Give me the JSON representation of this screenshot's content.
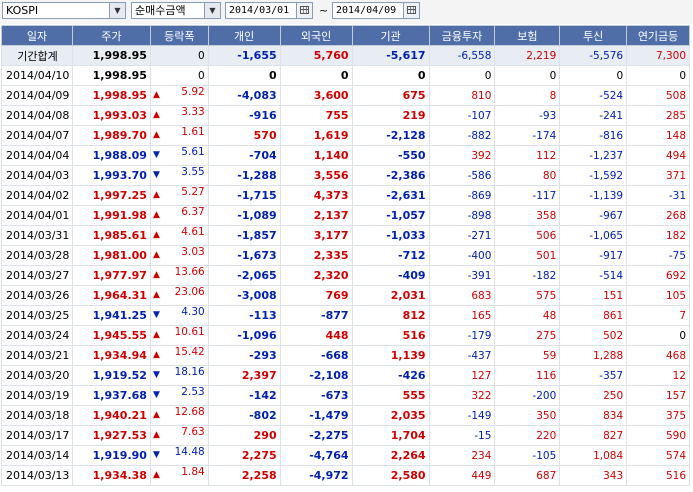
{
  "toolbar": {
    "market": "KOSPI",
    "mode": "순매수금액",
    "start_date": "2014/03/01",
    "tilde": "~",
    "end_date": "2014/04/09"
  },
  "headers": [
    "일자",
    "주가",
    "등락폭",
    "개인",
    "외국인",
    "기관",
    "금융투자",
    "보험",
    "투신",
    "연기금등"
  ],
  "colors": {
    "up": "#d00000",
    "down": "#0020b0",
    "header": "#4f6ea8"
  },
  "rows": [
    {
      "date": "기간합계",
      "price": "1,998.95",
      "dir": "",
      "chg": "0",
      "ind": "-1,655",
      "frn": "5,760",
      "ins": "-5,617",
      "fin": "-6,558",
      "insu": "2,219",
      "trust": "-5,576",
      "pen": "7,300",
      "total": true
    },
    {
      "date": "2014/04/10",
      "price": "1,998.95",
      "dir": "",
      "chg": "0",
      "ind": "0",
      "frn": "0",
      "ins": "0",
      "fin": "0",
      "insu": "0",
      "trust": "0",
      "pen": "0"
    },
    {
      "date": "2014/04/09",
      "price": "1,998.95",
      "dir": "up",
      "chg": "5.92",
      "ind": "-4,083",
      "frn": "3,600",
      "ins": "675",
      "fin": "810",
      "insu": "8",
      "trust": "-524",
      "pen": "508"
    },
    {
      "date": "2014/04/08",
      "price": "1,993.03",
      "dir": "up",
      "chg": "3.33",
      "ind": "-916",
      "frn": "755",
      "ins": "219",
      "fin": "-107",
      "insu": "-93",
      "trust": "-241",
      "pen": "285"
    },
    {
      "date": "2014/04/07",
      "price": "1,989.70",
      "dir": "up",
      "chg": "1.61",
      "ind": "570",
      "frn": "1,619",
      "ins": "-2,128",
      "fin": "-882",
      "insu": "-174",
      "trust": "-816",
      "pen": "148"
    },
    {
      "date": "2014/04/04",
      "price": "1,988.09",
      "dir": "dn",
      "chg": "5.61",
      "ind": "-704",
      "frn": "1,140",
      "ins": "-550",
      "fin": "392",
      "insu": "112",
      "trust": "-1,237",
      "pen": "494"
    },
    {
      "date": "2014/04/03",
      "price": "1,993.70",
      "dir": "dn",
      "chg": "3.55",
      "ind": "-1,288",
      "frn": "3,556",
      "ins": "-2,386",
      "fin": "-586",
      "insu": "80",
      "trust": "-1,592",
      "pen": "371"
    },
    {
      "date": "2014/04/02",
      "price": "1,997.25",
      "dir": "up",
      "chg": "5.27",
      "ind": "-1,715",
      "frn": "4,373",
      "ins": "-2,631",
      "fin": "-869",
      "insu": "-117",
      "trust": "-1,139",
      "pen": "-31"
    },
    {
      "date": "2014/04/01",
      "price": "1,991.98",
      "dir": "up",
      "chg": "6.37",
      "ind": "-1,089",
      "frn": "2,137",
      "ins": "-1,057",
      "fin": "-898",
      "insu": "358",
      "trust": "-967",
      "pen": "268"
    },
    {
      "date": "2014/03/31",
      "price": "1,985.61",
      "dir": "up",
      "chg": "4.61",
      "ind": "-1,857",
      "frn": "3,177",
      "ins": "-1,033",
      "fin": "-271",
      "insu": "506",
      "trust": "-1,065",
      "pen": "182"
    },
    {
      "date": "2014/03/28",
      "price": "1,981.00",
      "dir": "up",
      "chg": "3.03",
      "ind": "-1,673",
      "frn": "2,335",
      "ins": "-712",
      "fin": "-400",
      "insu": "501",
      "trust": "-917",
      "pen": "-75"
    },
    {
      "date": "2014/03/27",
      "price": "1,977.97",
      "dir": "up",
      "chg": "13.66",
      "ind": "-2,065",
      "frn": "2,320",
      "ins": "-409",
      "fin": "-391",
      "insu": "-182",
      "trust": "-514",
      "pen": "692"
    },
    {
      "date": "2014/03/26",
      "price": "1,964.31",
      "dir": "up",
      "chg": "23.06",
      "ind": "-3,008",
      "frn": "769",
      "ins": "2,031",
      "fin": "683",
      "insu": "575",
      "trust": "151",
      "pen": "105"
    },
    {
      "date": "2014/03/25",
      "price": "1,941.25",
      "dir": "dn",
      "chg": "4.30",
      "ind": "-113",
      "frn": "-877",
      "ins": "812",
      "fin": "165",
      "insu": "48",
      "trust": "861",
      "pen": "7"
    },
    {
      "date": "2014/03/24",
      "price": "1,945.55",
      "dir": "up",
      "chg": "10.61",
      "ind": "-1,096",
      "frn": "448",
      "ins": "516",
      "fin": "-179",
      "insu": "275",
      "trust": "502",
      "pen": "0"
    },
    {
      "date": "2014/03/21",
      "price": "1,934.94",
      "dir": "up",
      "chg": "15.42",
      "ind": "-293",
      "frn": "-668",
      "ins": "1,139",
      "fin": "-437",
      "insu": "59",
      "trust": "1,288",
      "pen": "468"
    },
    {
      "date": "2014/03/20",
      "price": "1,919.52",
      "dir": "dn",
      "chg": "18.16",
      "ind": "2,397",
      "frn": "-2,108",
      "ins": "-426",
      "fin": "127",
      "insu": "116",
      "trust": "-357",
      "pen": "12"
    },
    {
      "date": "2014/03/19",
      "price": "1,937.68",
      "dir": "dn",
      "chg": "2.53",
      "ind": "-142",
      "frn": "-673",
      "ins": "555",
      "fin": "322",
      "insu": "-200",
      "trust": "250",
      "pen": "157"
    },
    {
      "date": "2014/03/18",
      "price": "1,940.21",
      "dir": "up",
      "chg": "12.68",
      "ind": "-802",
      "frn": "-1,479",
      "ins": "2,035",
      "fin": "-149",
      "insu": "350",
      "trust": "834",
      "pen": "375"
    },
    {
      "date": "2014/03/17",
      "price": "1,927.53",
      "dir": "up",
      "chg": "7.63",
      "ind": "290",
      "frn": "-2,275",
      "ins": "1,704",
      "fin": "-15",
      "insu": "220",
      "trust": "827",
      "pen": "590"
    },
    {
      "date": "2014/03/14",
      "price": "1,919.90",
      "dir": "dn",
      "chg": "14.48",
      "ind": "2,275",
      "frn": "-4,764",
      "ins": "2,264",
      "fin": "234",
      "insu": "-105",
      "trust": "1,084",
      "pen": "574"
    },
    {
      "date": "2014/03/13",
      "price": "1,934.38",
      "dir": "up",
      "chg": "1.84",
      "ind": "2,258",
      "frn": "-4,972",
      "ins": "2,580",
      "fin": "449",
      "insu": "687",
      "trust": "343",
      "pen": "516"
    }
  ]
}
